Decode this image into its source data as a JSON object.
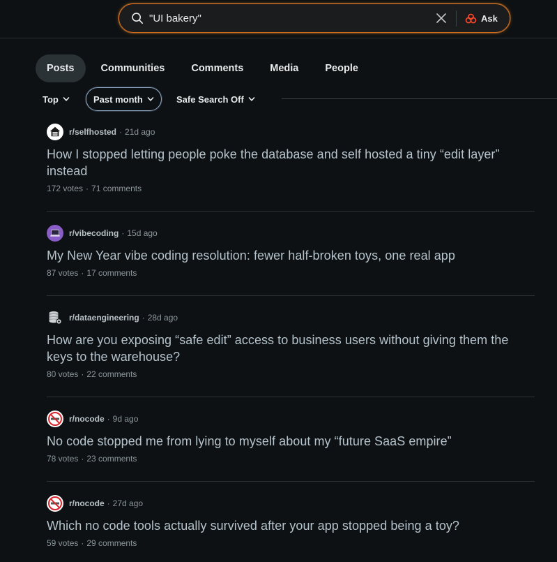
{
  "search": {
    "query": "\"UI bakery\"",
    "ask_label": "Ask"
  },
  "tabs": [
    {
      "label": "Posts",
      "active": true
    },
    {
      "label": "Communities",
      "active": false
    },
    {
      "label": "Comments",
      "active": false
    },
    {
      "label": "Media",
      "active": false
    },
    {
      "label": "People",
      "active": false
    }
  ],
  "filters": {
    "sort": "Top",
    "time": "Past month",
    "safe_search": "Safe Search Off"
  },
  "posts": [
    {
      "subreddit": "r/selfhosted",
      "age": "21d ago",
      "title": "How I stopped letting people poke the database and self hosted a tiny “edit layer” instead",
      "votes": "172 votes",
      "comments": "71 comments",
      "icon": "house-icon"
    },
    {
      "subreddit": "r/vibecoding",
      "age": "15d ago",
      "title": "My New Year vibe coding resolution: fewer half-broken toys, one real app",
      "votes": "87 votes",
      "comments": "17 comments",
      "icon": "laptop-icon"
    },
    {
      "subreddit": "r/dataengineering",
      "age": "28d ago",
      "title": "How are you exposing “safe edit” access to business users without giving them the keys to the warehouse?",
      "votes": "80 votes",
      "comments": "22 comments",
      "icon": "database-gear-icon"
    },
    {
      "subreddit": "r/nocode",
      "age": "9d ago",
      "title": "No code stopped me from lying to myself about my “future SaaS empire”",
      "votes": "78 votes",
      "comments": "23 comments",
      "icon": "no-code-icon"
    },
    {
      "subreddit": "r/nocode",
      "age": "27d ago",
      "title": "Which no code tools actually survived after your app stopped being a toy?",
      "votes": "59 votes",
      "comments": "29 comments",
      "icon": "no-code-icon"
    }
  ],
  "colors": {
    "background": "#0e1113",
    "search_border": "#d66a1e",
    "selected_filter_border": "#8ea9c8",
    "active_tab": "#2a3236",
    "title_text": "#b5c3cc",
    "meta_text": "#8c979c"
  }
}
